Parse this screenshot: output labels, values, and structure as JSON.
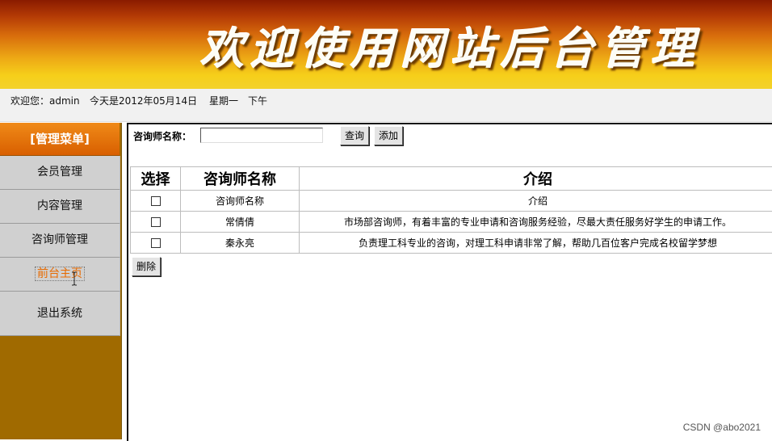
{
  "banner": {
    "title": "欢迎使用网站后台管理"
  },
  "welcome": {
    "greeting": "欢迎您：admin",
    "date": "今天是2012年05月14日",
    "weekday": "星期一",
    "period": "下午"
  },
  "sidebar": {
    "header": "[管理菜单]",
    "items": [
      {
        "label": "会员管理"
      },
      {
        "label": "内容管理"
      },
      {
        "label": "咨询师管理"
      },
      {
        "label": "前台主页"
      },
      {
        "label": "退出系统"
      }
    ]
  },
  "search": {
    "label": "咨询师名称：",
    "value": "",
    "query_button": "查询",
    "add_button": "添加"
  },
  "table": {
    "headers": [
      "选择",
      "咨询师名称",
      "介绍"
    ],
    "rows": [
      {
        "name": "咨询师名称",
        "intro": "介绍"
      },
      {
        "name": "常倩倩",
        "intro": "市场部咨询师，有着丰富的专业申请和咨询服务经验，尽最大责任服务好学生的申请工作。"
      },
      {
        "name": "秦永亮",
        "intro": "负责理工科专业的咨询，对理工科申请非常了解，帮助几百位客户完成名校留学梦想"
      }
    ]
  },
  "delete_button": "删除",
  "watermark": "CSDN @abo2021",
  "colors": {
    "menu_header": "#e07010",
    "sidebar_bg": "#a06a00",
    "menu_item_bg": "#d0d0d0",
    "active_menu_text": "#e86a00"
  }
}
